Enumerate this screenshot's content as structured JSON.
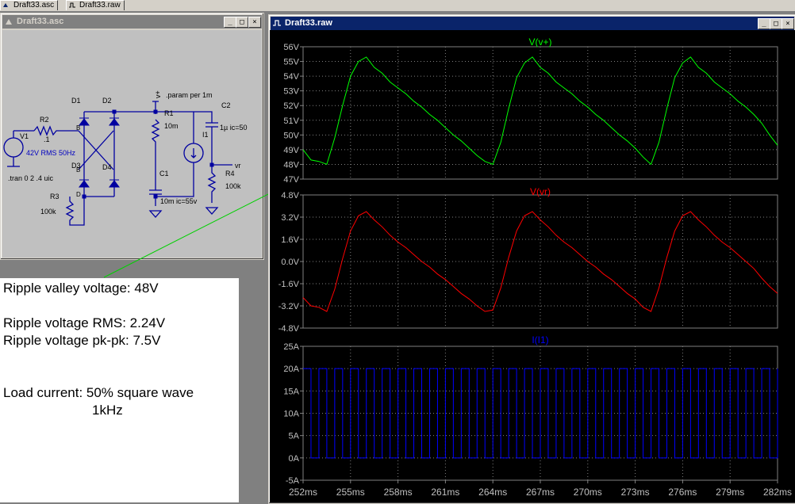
{
  "tabs": [
    {
      "label": "Draft33.asc"
    },
    {
      "label": "Draft33.raw"
    }
  ],
  "schematic_window": {
    "title": "Draft33.asc",
    "labels": {
      "v1": "V1",
      "v1_val": "42V RMS 50Hz",
      "r2": "R2",
      "r2_val": ".1",
      "d1": "D1",
      "d2": "D2",
      "d3": "D3",
      "d4": "D4",
      "tran": ".tran 0 2 .4 uic",
      "r3": "R3",
      "r3_val": "100k",
      "vplus": "v+",
      "param": ".param per 1m",
      "r1": "R1",
      "r1_val": "10m",
      "i1": "I1",
      "c1": "C1",
      "c1_val": "10m ic=55v",
      "c2": "C2",
      "c2_val": "1µ ic=50",
      "r4": "R4",
      "r4_val": "100k",
      "vr": "vr",
      "pin_b": "B",
      "pin_d": "D"
    }
  },
  "waveform_window": {
    "title": "Draft33.raw"
  },
  "notes": {
    "line1": "Ripple valley voltage: 48V",
    "line2": "Ripple voltage RMS: 2.24V",
    "line3": "Ripple voltage pk-pk: 7.5V",
    "line4": "Load current: 50% square wave",
    "line5": "1kHz"
  },
  "colors": {
    "trace_v_plus": "#00ff00",
    "trace_vr": "#ff0000",
    "trace_i1": "#0000ff",
    "titlebar_active": "#0a246a",
    "plot_bg": "#000000"
  },
  "chart_data": [
    {
      "type": "line",
      "title": "V(v+)",
      "x_tick_labels": [
        "252ms",
        "255ms",
        "258ms",
        "261ms",
        "264ms",
        "267ms",
        "270ms",
        "273ms",
        "276ms",
        "279ms",
        "282ms"
      ],
      "y_tick_labels": [
        "56V",
        "55V",
        "54V",
        "53V",
        "52V",
        "51V",
        "50V",
        "49V",
        "48V",
        "47V"
      ],
      "xlim": [
        252,
        282
      ],
      "ylim": [
        47,
        56
      ],
      "series": [
        {
          "name": "V(v+)",
          "color": "#00ff00",
          "x": [
            252,
            252.5,
            253,
            253.5,
            254,
            254.5,
            255,
            255.5,
            256,
            256.5,
            257,
            257.5,
            258,
            258.5,
            259,
            259.5,
            260,
            260.5,
            261,
            261.5,
            262,
            262.5,
            263,
            263.5,
            264,
            264.5,
            265,
            265.5,
            266,
            266.5,
            267,
            267.5,
            268,
            268.5,
            269,
            269.5,
            270,
            270.5,
            271,
            271.5,
            272,
            272.5,
            273,
            273.5,
            274,
            274.5,
            275,
            275.5,
            276,
            276.5,
            277,
            277.5,
            278,
            278.5,
            279,
            279.5,
            280,
            280.5,
            281,
            281.5,
            282
          ],
          "y": [
            49.0,
            48.3,
            48.2,
            48.0,
            49.8,
            52.0,
            54.0,
            55.0,
            55.3,
            54.6,
            54.2,
            53.6,
            53.2,
            52.8,
            52.3,
            51.9,
            51.4,
            51.0,
            50.5,
            50.0,
            49.6,
            49.1,
            48.6,
            48.2,
            48.0,
            49.5,
            51.8,
            53.9,
            54.9,
            55.3,
            54.6,
            54.2,
            53.6,
            53.2,
            52.8,
            52.3,
            51.9,
            51.4,
            51.0,
            50.5,
            50.0,
            49.6,
            49.1,
            48.5,
            48.0,
            49.5,
            51.8,
            53.9,
            54.9,
            55.3,
            54.6,
            54.2,
            53.6,
            53.2,
            52.8,
            52.3,
            51.9,
            51.4,
            50.8,
            50.0,
            49.3
          ]
        }
      ]
    },
    {
      "type": "line",
      "title": "V(vr)",
      "x_tick_labels": [
        "252ms",
        "255ms",
        "258ms",
        "261ms",
        "264ms",
        "267ms",
        "270ms",
        "273ms",
        "276ms",
        "279ms",
        "282ms"
      ],
      "y_tick_labels": [
        "4.8V",
        "3.2V",
        "1.6V",
        "0.0V",
        "-1.6V",
        "-3.2V",
        "-4.8V"
      ],
      "xlim": [
        252,
        282
      ],
      "ylim": [
        -4.8,
        4.8
      ],
      "series": [
        {
          "name": "V(vr)",
          "color": "#ff0000",
          "x": [
            252,
            252.5,
            253,
            253.5,
            254,
            254.5,
            255,
            255.5,
            256,
            256.5,
            257,
            257.5,
            258,
            258.5,
            259,
            259.5,
            260,
            260.5,
            261,
            261.5,
            262,
            262.5,
            263,
            263.5,
            264,
            264.5,
            265,
            265.5,
            266,
            266.5,
            267,
            267.5,
            268,
            268.5,
            269,
            269.5,
            270,
            270.5,
            271,
            271.5,
            272,
            272.5,
            273,
            273.5,
            274,
            274.5,
            275,
            275.5,
            276,
            276.5,
            277,
            277.5,
            278,
            278.5,
            279,
            279.5,
            280,
            280.5,
            281,
            281.5,
            282
          ],
          "y": [
            -2.6,
            -3.2,
            -3.3,
            -3.6,
            -2.0,
            0.2,
            2.2,
            3.3,
            3.6,
            3.0,
            2.5,
            1.9,
            1.4,
            1.0,
            0.5,
            0.0,
            -0.4,
            -0.9,
            -1.3,
            -1.8,
            -2.3,
            -2.7,
            -3.2,
            -3.6,
            -3.5,
            -1.9,
            0.3,
            2.2,
            3.3,
            3.6,
            3.0,
            2.5,
            1.9,
            1.4,
            1.0,
            0.5,
            0.0,
            -0.4,
            -0.9,
            -1.3,
            -1.8,
            -2.3,
            -2.7,
            -3.3,
            -3.6,
            -1.9,
            0.3,
            2.2,
            3.3,
            3.6,
            3.0,
            2.5,
            1.9,
            1.4,
            1.0,
            0.5,
            0.0,
            -0.5,
            -1.2,
            -1.8,
            -2.3
          ]
        }
      ]
    },
    {
      "type": "line",
      "title": "I(I1)",
      "x_tick_labels": [
        "252ms",
        "255ms",
        "258ms",
        "261ms",
        "264ms",
        "267ms",
        "270ms",
        "273ms",
        "276ms",
        "279ms",
        "282ms"
      ],
      "y_tick_labels": [
        "25A",
        "20A",
        "15A",
        "10A",
        "5A",
        "0A",
        "-5A"
      ],
      "xlim": [
        252,
        282
      ],
      "ylim": [
        -5,
        25
      ],
      "series": [
        {
          "name": "I(I1)",
          "color": "#0000ff",
          "waveform": "square",
          "period_ms": 1,
          "duty": 0.5,
          "low": 0,
          "high": 20,
          "start_ms": 252
        }
      ]
    }
  ]
}
